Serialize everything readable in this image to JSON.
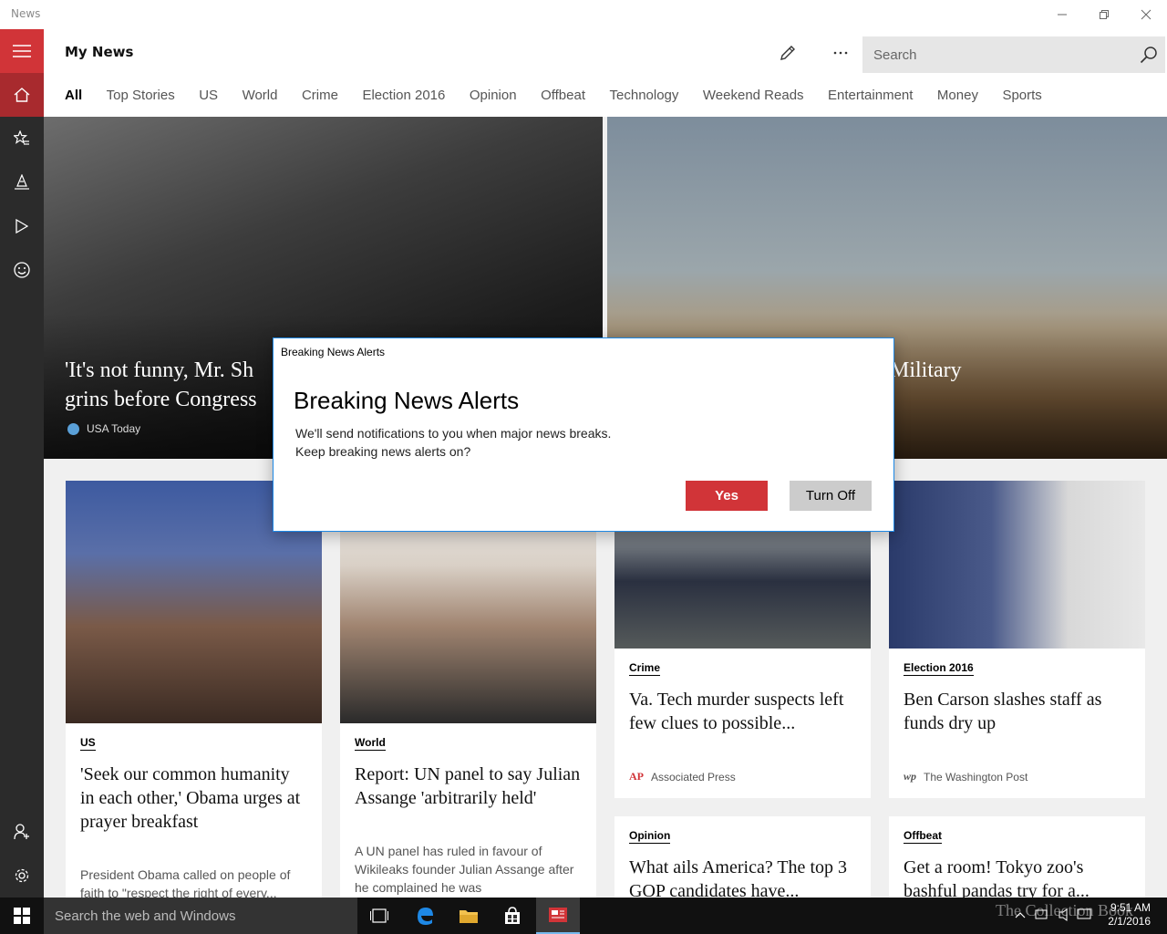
{
  "window": {
    "title": "News"
  },
  "header": {
    "title": "My News",
    "search_placeholder": "Search"
  },
  "tabs": [
    "All",
    "Top Stories",
    "US",
    "World",
    "Crime",
    "Election 2016",
    "Opinion",
    "Offbeat",
    "Technology",
    "Weekend Reads",
    "Entertainment",
    "Money",
    "Sports"
  ],
  "hero": [
    {
      "headline_line1": "'It's not funny, Mr. Sh",
      "headline_line2": "grins before Congress",
      "source": "USA Today"
    },
    {
      "headline_line1": "Military",
      "headline_line2": ""
    }
  ],
  "cards": [
    {
      "category": "US",
      "title": "'Seek our common humanity in each other,' Obama urges at prayer breakfast",
      "summary": "President Obama called on people of faith to \"respect the right of every..."
    },
    {
      "category": "World",
      "title": "Report: UN panel to say Julian Assange 'arbitrarily held'",
      "summary": "A UN panel has ruled in favour of Wikileaks founder Julian Assange after he complained he was"
    },
    {
      "category": "Crime",
      "title": "Va. Tech murder suspects left few clues to possible...",
      "source": "Associated Press",
      "source_logo": "AP"
    },
    {
      "category": "Election 2016",
      "title": "Ben Carson slashes staff as funds dry up",
      "source": "The Washington Post",
      "source_logo": "wp"
    },
    {
      "category": "Opinion",
      "title": "What ails America? The top 3 GOP candidates have..."
    },
    {
      "category": "Offbeat",
      "title": "Get a room! Tokyo zoo's bashful pandas try for a..."
    }
  ],
  "dialog": {
    "caption": "Breaking News Alerts",
    "title": "Breaking News Alerts",
    "body_line1": "We'll send notifications to you when major news breaks.",
    "body_line2": "Keep breaking news alerts on?",
    "yes_label": "Yes",
    "off_label": "Turn Off"
  },
  "taskbar": {
    "search_text": "Search the web and Windows",
    "time": "9:51 AM",
    "date": "2/1/2016",
    "watermark": "The Collection Book"
  },
  "colors": {
    "accent": "#d13438",
    "nav_bg": "#2b2b2b",
    "taskbar_bg": "#111111"
  }
}
